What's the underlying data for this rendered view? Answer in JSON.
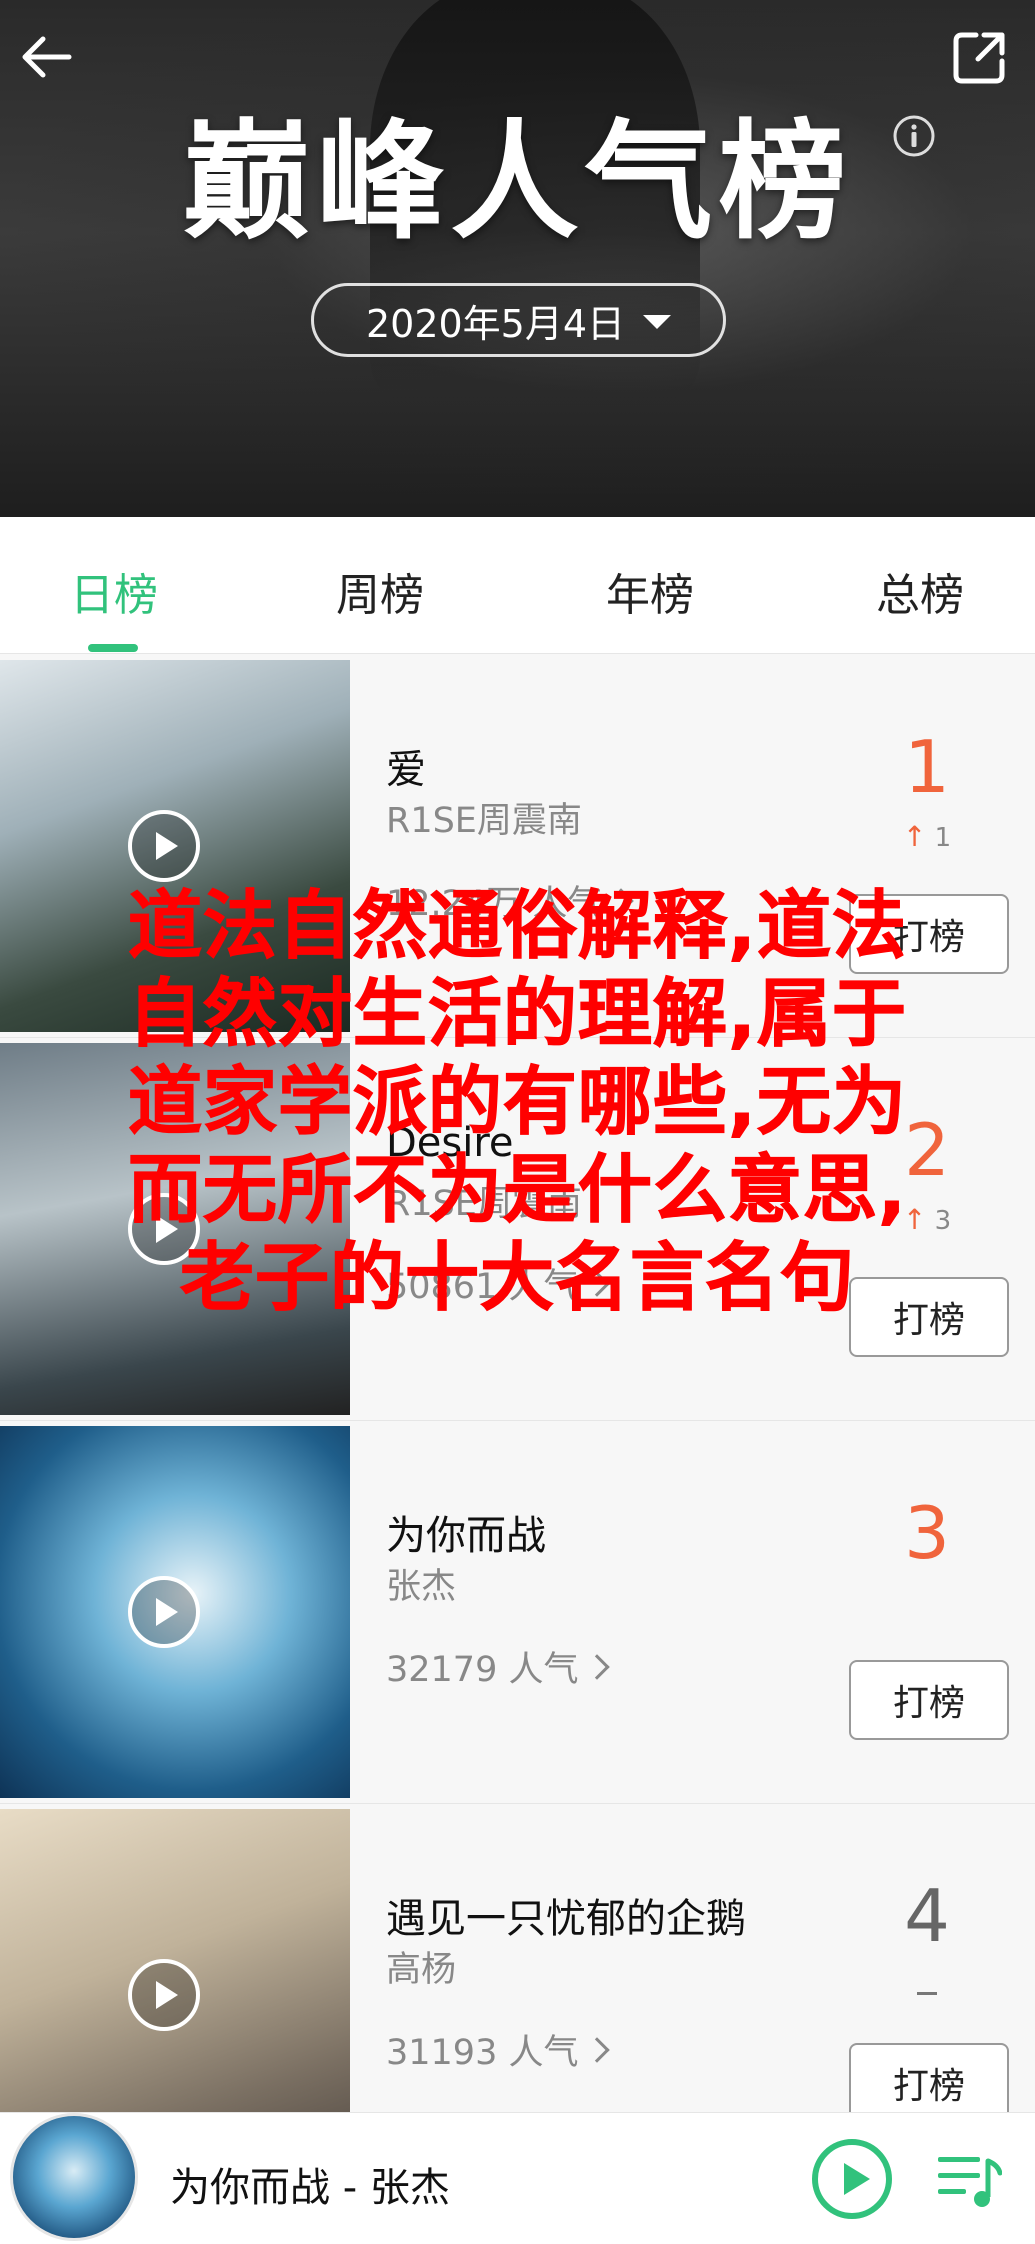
{
  "header": {
    "title": "巅峰人气榜",
    "date": "2020年5月4日"
  },
  "tabs": [
    {
      "label": "日榜",
      "active": true
    },
    {
      "label": "周榜",
      "active": false
    },
    {
      "label": "年榜",
      "active": false
    },
    {
      "label": "总榜",
      "active": false
    }
  ],
  "songs": [
    {
      "title": "爱",
      "artist": "R1SE周震南",
      "popularity": "12.24万 人气",
      "rank": "1",
      "change": "1",
      "change_dir": "up",
      "vote_label": "打榜"
    },
    {
      "title": "Desire",
      "artist": "R1SE周震南",
      "popularity": "50861 人气",
      "rank": "2",
      "change": "3",
      "change_dir": "up",
      "vote_label": "打榜"
    },
    {
      "title": "为你而战",
      "artist": "张杰",
      "popularity": "32179 人气",
      "rank": "3",
      "change": "",
      "change_dir": "none",
      "vote_label": "打榜"
    },
    {
      "title": "遇见一只忧郁的企鹅",
      "artist": "高杨",
      "popularity": "31193 人气",
      "rank": "4",
      "change": "–",
      "change_dir": "same",
      "vote_label": "打榜"
    }
  ],
  "overlay_text": {
    "line1": "道法自然通俗解释,道法",
    "line2": "自然对生活的理解,属于",
    "line3": "道家学派的有哪些,无为",
    "line4": "而无所不为是什么意思,",
    "line5": "老子的十大名言名句"
  },
  "player": {
    "now_playing": "为你而战 - 张杰"
  },
  "colors": {
    "accent": "#31c27c",
    "rank_hot": "#f0643c",
    "overlay": "#ff0000"
  }
}
